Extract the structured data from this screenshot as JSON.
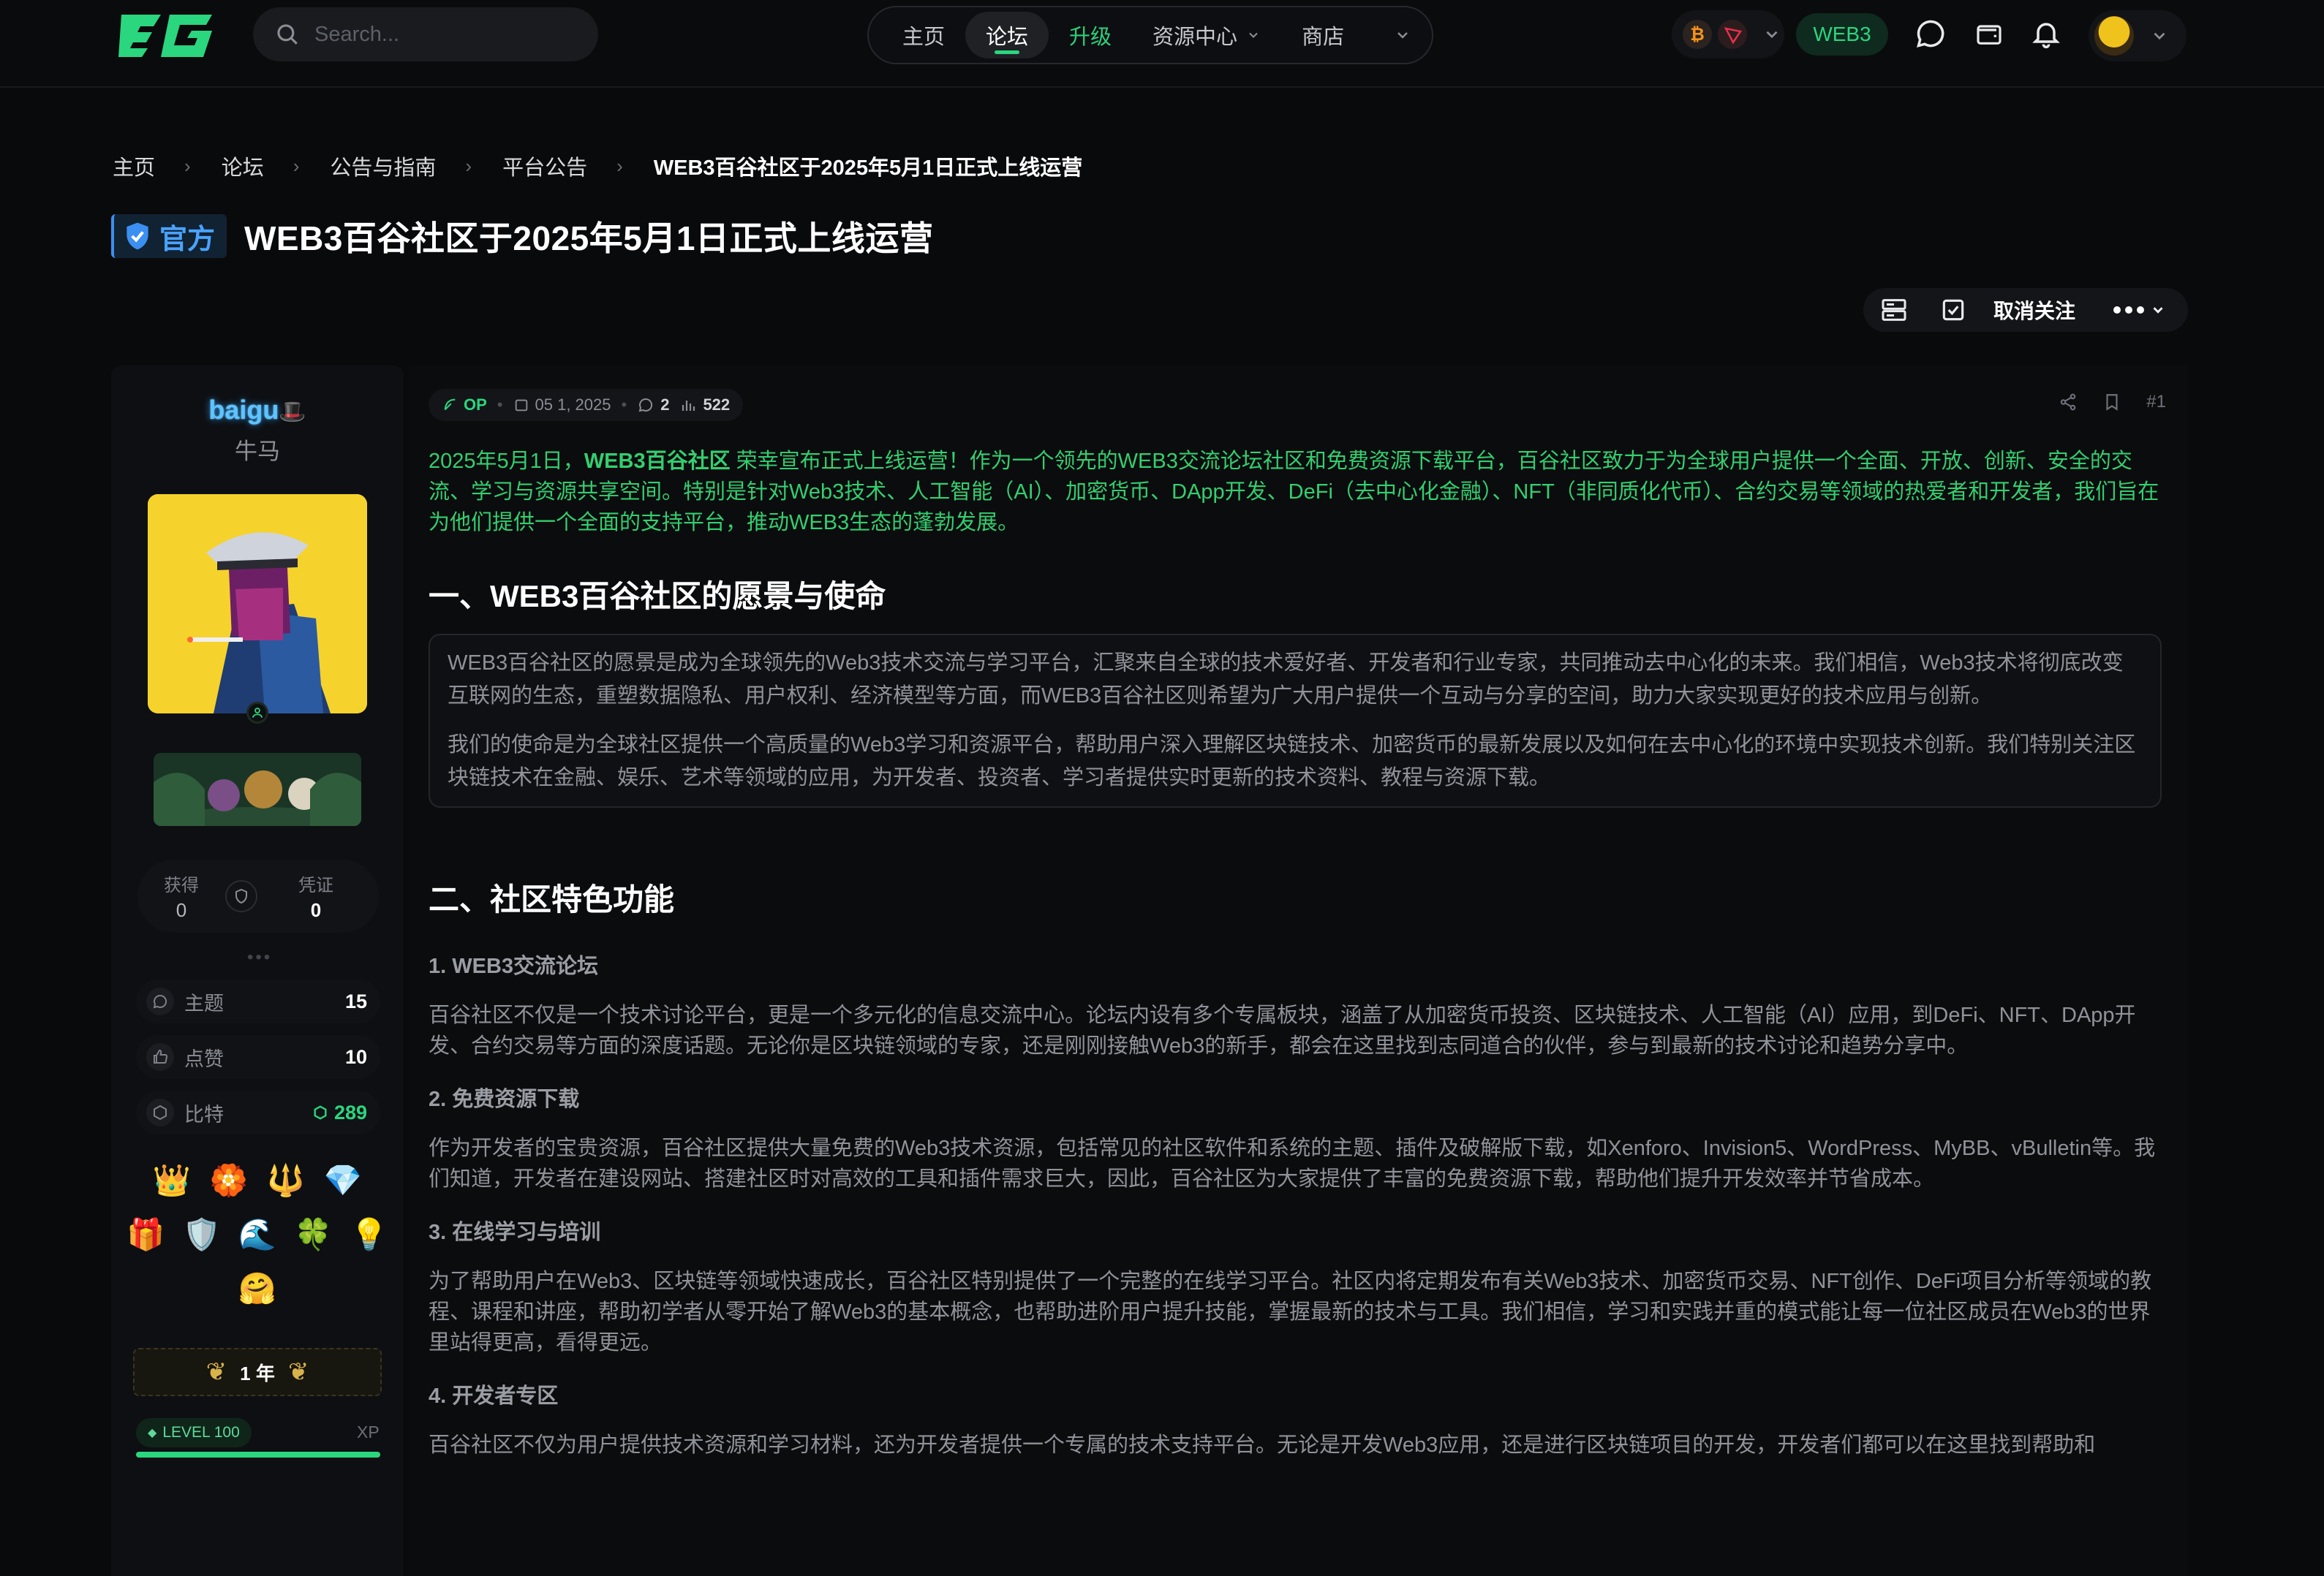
{
  "nav": {
    "search_placeholder": "Search...",
    "items": [
      {
        "label": "主页"
      },
      {
        "label": "论坛"
      },
      {
        "label": "升级"
      },
      {
        "label": "资源中心"
      },
      {
        "label": "商店"
      }
    ],
    "web3_label": "WEB3",
    "accent": "#2ad67e"
  },
  "breadcrumb": [
    "主页",
    "论坛",
    "公告与指南",
    "平台公告",
    "WEB3百谷社区于2025年5月1日正式上线运营"
  ],
  "thread": {
    "official_label": "官方",
    "title": "WEB3百谷社区于2025年5月1日正式上线运营",
    "unfollow_label": "取消关注"
  },
  "user": {
    "name": "baigu",
    "title": "牛马",
    "earned_label": "获得",
    "earned_value": "0",
    "cred_label": "凭证",
    "cred_value": "0",
    "stats": [
      {
        "label": "主题",
        "value": "15"
      },
      {
        "label": "点赞",
        "value": "10"
      },
      {
        "label": "比特",
        "value": "289"
      }
    ],
    "year_label": "1 年",
    "level_label": "LEVEL 100",
    "xp_label": "XP",
    "xp_progress": 1.0
  },
  "post": {
    "op_label": "OP",
    "date": "05 1, 2025",
    "replies": "2",
    "views": "522",
    "post_number": "#1",
    "lead_bold": "WEB3百谷社区",
    "lead_pre": "2025年5月1日，",
    "lead_post": " 荣幸宣布正式上线运营！作为一个领先的WEB3交流论坛社区和免费资源下载平台，百谷社区致力于为全球用户提供一个全面、开放、创新、安全的交流、学习与资源共享空间。特别是针对Web3技术、人工智能（AI）、加密货币、DApp开发、DeFi（去中心化金融）、NFT（非同质化代币）、合约交易等领域的热爱者和开发者，我们旨在为他们提供一个全面的支持平台，推动WEB3生态的蓬勃发展。",
    "h1": "一、WEB3百谷社区的愿景与使命",
    "quote_p1": "WEB3百谷社区的愿景是成为全球领先的Web3技术交流与学习平台，汇聚来自全球的技术爱好者、开发者和行业专家，共同推动去中心化的未来。我们相信，Web3技术将彻底改变互联网的生态，重塑数据隐私、用户权利、经济模型等方面，而WEB3百谷社区则希望为广大用户提供一个互动与分享的空间，助力大家实现更好的技术应用与创新。",
    "quote_p2": "我们的使命是为全球社区提供一个高质量的Web3学习和资源平台，帮助用户深入理解区块链技术、加密货币的最新发展以及如何在去中心化的环境中实现技术创新。我们特别关注区块链技术在金融、娱乐、艺术等领域的应用，为开发者、投资者、学习者提供实时更新的技术资料、教程与资源下载。",
    "h2": "二、社区特色功能",
    "s1_title": "1. WEB3交流论坛",
    "s1_text": "百谷社区不仅是一个技术讨论平台，更是一个多元化的信息交流中心。论坛内设有多个专属板块，涵盖了从加密货币投资、区块链技术、人工智能（AI）应用，到DeFi、NFT、DApp开发、合约交易等方面的深度话题。无论你是区块链领域的专家，还是刚刚接触Web3的新手，都会在这里找到志同道合的伙伴，参与到最新的技术讨论和趋势分享中。",
    "s2_title": "2. 免费资源下载",
    "s2_text": "作为开发者的宝贵资源，百谷社区提供大量免费的Web3技术资源，包括常见的社区软件和系统的主题、插件及破解版下载，如Xenforo、Invision5、WordPress、MyBB、vBulletin等。我们知道，开发者在建设网站、搭建社区时对高效的工具和插件需求巨大，因此，百谷社区为大家提供了丰富的免费资源下载，帮助他们提升开发效率并节省成本。",
    "s3_title": "3. 在线学习与培训",
    "s3_text": "为了帮助用户在Web3、区块链等领域快速成长，百谷社区特别提供了一个完整的在线学习平台。社区内将定期发布有关Web3技术、加密货币交易、NFT创作、DeFi项目分析等领域的教程、课程和讲座，帮助初学者从零开始了解Web3的基本概念，也帮助进阶用户提升技能，掌握最新的技术与工具。我们相信，学习和实践并重的模式能让每一位社区成员在Web3的世界里站得更高，看得更远。",
    "s4_title": "4. 开发者专区",
    "s4_text": "百谷社区不仅为用户提供技术资源和学习材料，还为开发者提供一个专属的技术支持平台。无论是开发Web3应用，还是进行区块链项目的开发，开发者们都可以在这里找到帮助和"
  }
}
